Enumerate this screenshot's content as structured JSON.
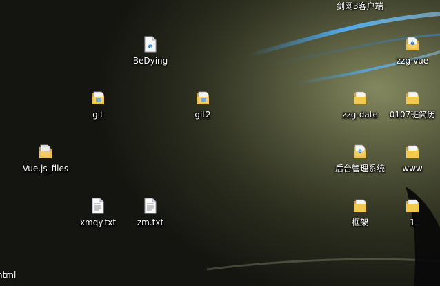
{
  "desktop": {
    "top_partial_label": "剑网3客户端",
    "bottom_partial_label": "html",
    "icons": [
      {
        "label": "BeDying",
        "type": "html-file",
        "icon": "edge-html-file-icon"
      },
      {
        "label": "git",
        "type": "folder-shortcut",
        "icon": "folder-shortcut-icon"
      },
      {
        "label": "git2",
        "type": "folder-shortcut",
        "icon": "folder-shortcut-icon"
      },
      {
        "label": "Vue.js_files",
        "type": "folder-files",
        "icon": "folder-files-icon"
      },
      {
        "label": "xmqy.txt",
        "type": "text-file",
        "icon": "text-file-icon"
      },
      {
        "label": "zm.txt",
        "type": "text-file",
        "icon": "text-file-icon"
      },
      {
        "label": "zzg-vue",
        "type": "html-file",
        "icon": "edge-html-file-icon"
      },
      {
        "label": "zzg-date",
        "type": "folder",
        "icon": "folder-icon"
      },
      {
        "label": "0107班简历",
        "type": "folder",
        "icon": "folder-icon"
      },
      {
        "label": "后台管理系统",
        "type": "html-file",
        "icon": "edge-html-file-icon"
      },
      {
        "label": "www",
        "type": "folder",
        "icon": "folder-icon"
      },
      {
        "label": "框架",
        "type": "folder",
        "icon": "folder-icon"
      },
      {
        "label": "1",
        "type": "folder",
        "icon": "folder-icon"
      }
    ]
  },
  "colors": {
    "folder_yellow": "#f3c84f",
    "folder_dark": "#d9a12a",
    "label_text": "#ffffff",
    "edge_blue": "#1f7fd6",
    "swoosh_blue": "#4fb3ff"
  }
}
